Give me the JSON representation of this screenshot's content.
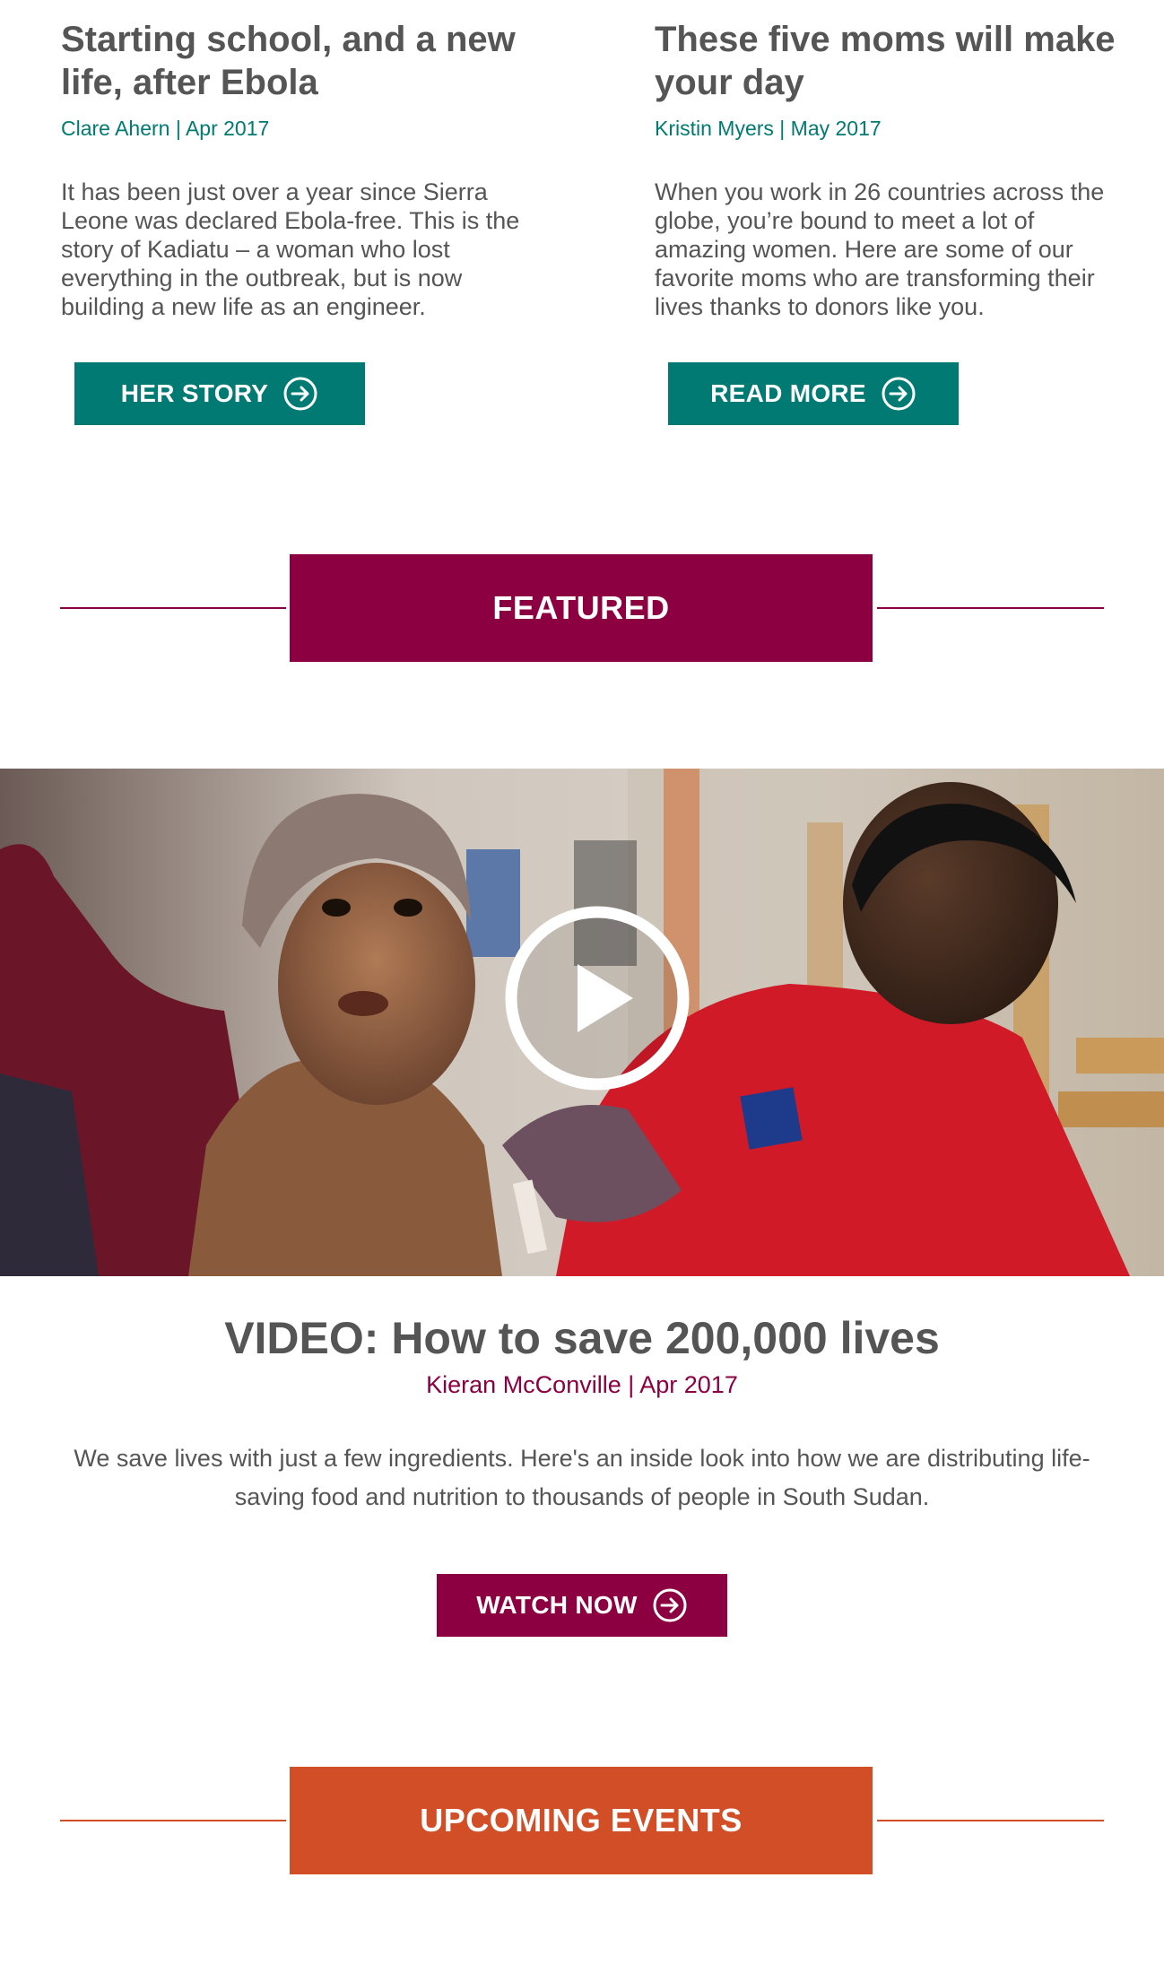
{
  "stories": [
    {
      "title": "Starting school, and a new life, after Ebola",
      "byline": "Clare Ahern | Apr 2017",
      "body": "It has been just over a year since Sierra Leone was declared Ebola-free. This is the story of Kadiatu – a woman who lost everything in the outbreak, but is now building a new life as an engineer.",
      "button_label": "HER STORY"
    },
    {
      "title": "These five moms will make your day",
      "byline": "Kristin Myers | May 2017",
      "body": "When you work in 26 countries across the globe, you’re bound to meet a lot of amazing women. Here are some of our favorite moms who are transforming their lives thanks to donors like you.",
      "button_label": "READ MORE"
    }
  ],
  "featured": {
    "section_label": "FEATURED",
    "title": "VIDEO: How to save 200,000 lives",
    "byline": "Kieran McConville | Apr 2017",
    "body": "We save lives with just a few ingredients. Here's an inside look into how we are distributing life-saving food and nutrition to thousands of people in South Sudan.",
    "button_label": "WATCH NOW"
  },
  "events": {
    "section_label": "UPCOMING EVENTS"
  },
  "colors": {
    "teal": "#007a73",
    "maroon": "#8c0042",
    "orange": "#d24e27",
    "text": "#555555"
  },
  "icons": {
    "button_arrow": "circle-arrow-right-icon",
    "video_play": "play-icon"
  }
}
